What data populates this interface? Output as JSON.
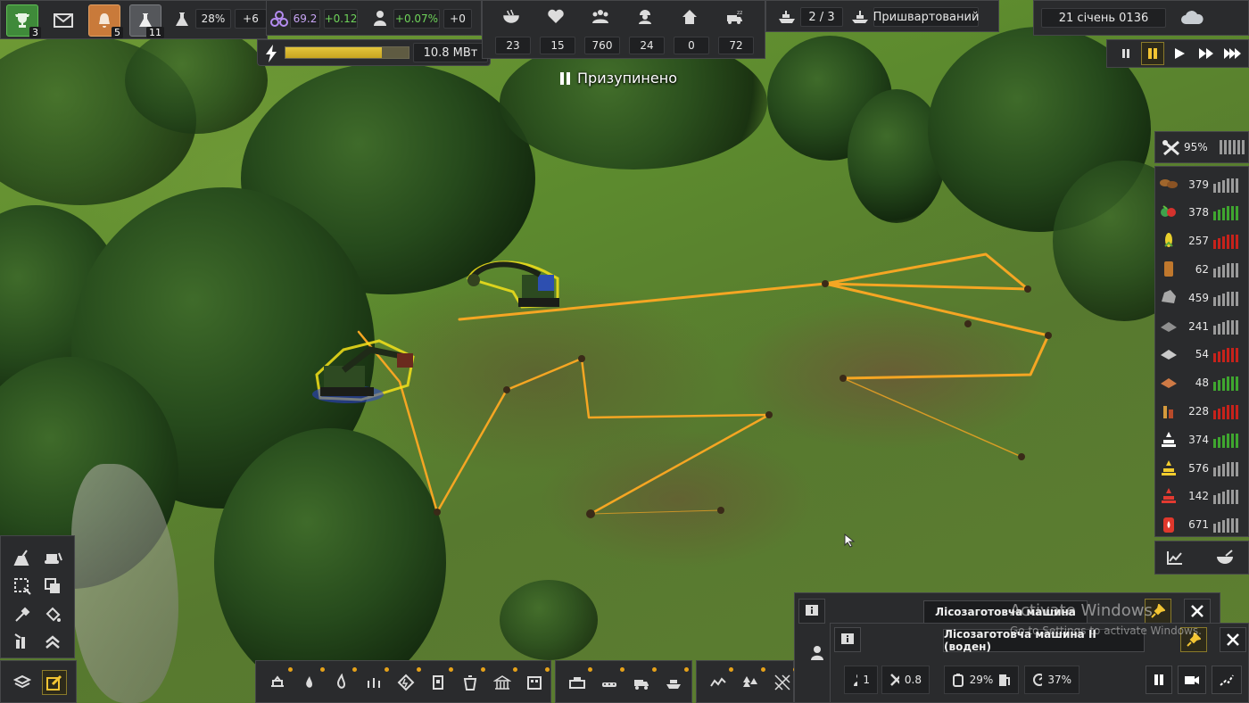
{
  "top_left": {
    "achievements_count": "3",
    "notifications_count": "5",
    "research_count": "11"
  },
  "unity": {
    "research_percent": "28%",
    "research_delta": "+6",
    "unity_value": "69.2",
    "unity_delta": "+0.12",
    "pop_growth": "+0.07%",
    "pop_delta": "+0"
  },
  "power": {
    "value": "10.8 МВт",
    "fill_fraction": 0.78
  },
  "population_stats": [
    "23",
    "15",
    "760",
    "24",
    "0",
    "72"
  ],
  "ships": {
    "count": "2 / 3",
    "status": "Пришвартований"
  },
  "date": "21 січень 0136",
  "paused_label": "Призупинено",
  "maintenance_percent": "95%",
  "resources": [
    {
      "icon": "wood-log-icon",
      "value": "379",
      "trend": "neutral"
    },
    {
      "icon": "vegetables-icon",
      "value": "378",
      "trend": "up"
    },
    {
      "icon": "corn-icon",
      "value": "257",
      "trend": "down"
    },
    {
      "icon": "wood-plank-icon",
      "value": "62",
      "trend": "neutral"
    },
    {
      "icon": "rock-icon",
      "value": "459",
      "trend": "neutral"
    },
    {
      "icon": "iron-plate-icon",
      "value": "241",
      "trend": "neutral"
    },
    {
      "icon": "steel-icon",
      "value": "54",
      "trend": "down"
    },
    {
      "icon": "brick-icon",
      "value": "48",
      "trend": "up"
    },
    {
      "icon": "construction-parts-icon",
      "value": "228",
      "trend": "down"
    },
    {
      "icon": "medical-supplies-icon",
      "value": "374",
      "trend": "up"
    },
    {
      "icon": "consumer-goods-icon",
      "value": "576",
      "trend": "neutral"
    },
    {
      "icon": "household-goods-icon",
      "value": "142",
      "trend": "neutral"
    },
    {
      "icon": "fuel-icon",
      "value": "671",
      "trend": "neutral"
    }
  ],
  "window_back": {
    "title": "Лісозаготовча машина"
  },
  "window_front": {
    "title": "Лісозаготовча машина II (воден)",
    "workers": "1",
    "maintenance": "0.8",
    "fuel_percent": "29%",
    "efficiency_percent": "37%"
  },
  "watermark": {
    "title": "Activate Windows",
    "subtitle": "Go to Settings to activate Windows."
  },
  "colors": {
    "route": "#f5a623",
    "selection_glow": "#f4e21a",
    "panel_bg": "#2a2b2d",
    "trend_up": "#3fa62f",
    "trend_down": "#c7221b",
    "trend_neutral": "#9b9b9b",
    "power_fill": "#d9b62b"
  }
}
